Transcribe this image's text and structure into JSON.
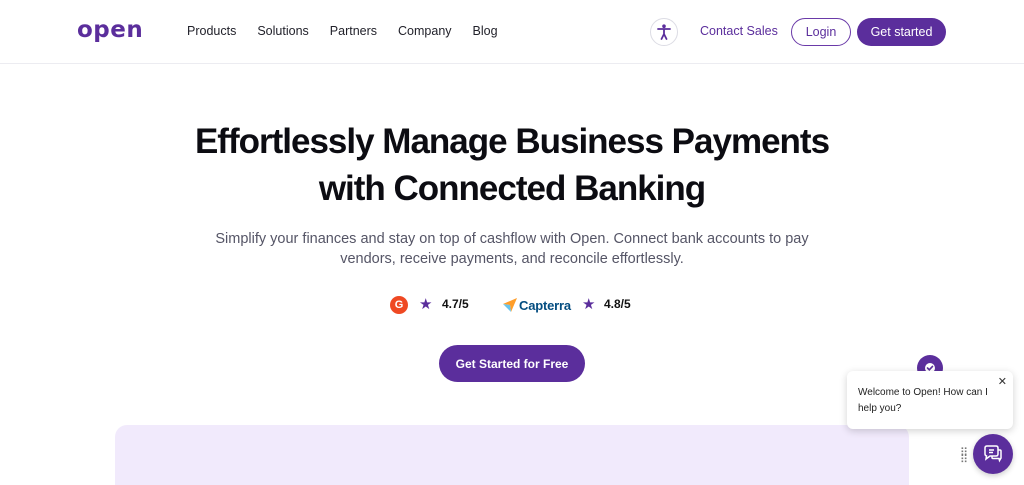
{
  "header": {
    "logo": "open",
    "nav": [
      "Products",
      "Solutions",
      "Partners",
      "Company",
      "Blog"
    ],
    "accessibility_icon": "accessibility-icon",
    "contact_label": "Contact Sales",
    "login_label": "Login",
    "get_started_label": "Get started"
  },
  "hero": {
    "title_line1": "Effortlessly Manage Business Payments",
    "title_line2": "with Connected Banking",
    "subtitle_line1": "Simplify your finances and stay on top of cashflow with Open. Connect bank accounts to pay",
    "subtitle_line2": "vendors, receive payments, and reconcile effortlessly.",
    "ratings": [
      {
        "source": "G2",
        "logo_text": "G",
        "icon": "star-icon",
        "value": "4.7/5"
      },
      {
        "source": "Capterra",
        "logo_text": "Capterra",
        "icon": "star-icon",
        "value": "4.8/5"
      }
    ],
    "cta_label": "Get Started for Free"
  },
  "chat": {
    "message": "Welcome to Open! How can I help you?",
    "close_glyph": "✕"
  },
  "colors": {
    "brand": "#5b2e9c",
    "panel": "#f1eafc",
    "g2": "#ef4923",
    "capterra": "#044d80"
  }
}
